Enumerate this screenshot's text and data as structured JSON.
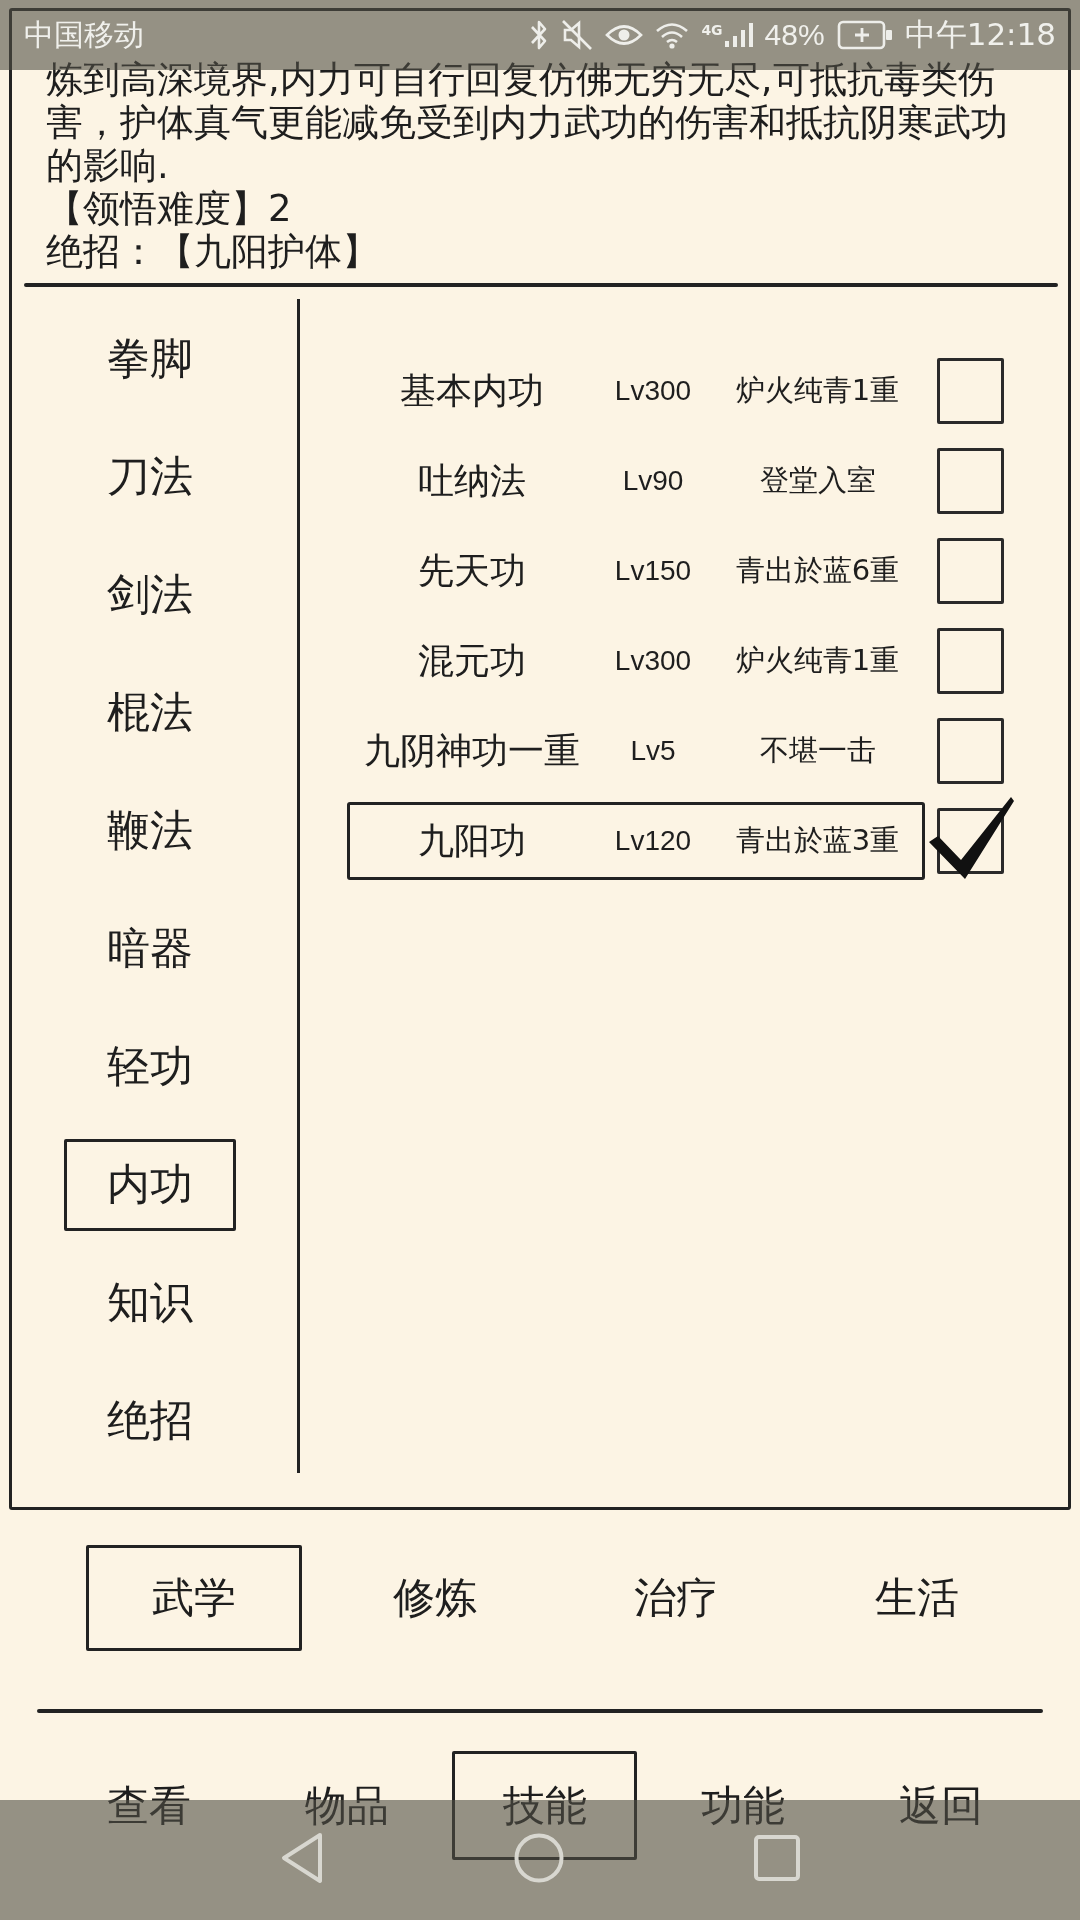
{
  "status_bar": {
    "carrier": "中国移动",
    "network": "4G",
    "battery": "48%",
    "time": "中午12:18"
  },
  "skill_info": {
    "description": "炼到高深境界,内力可自行回复仿佛无穷无尽,可抵抗毒类伤害，护体真气更能减免受到内力武功的伤害和抵抗阴寒武功的影响.",
    "difficulty": "【领悟难度】2",
    "ultimate": "绝招：【九阳护体】"
  },
  "categories": [
    {
      "label": "拳脚",
      "selected": false
    },
    {
      "label": "刀法",
      "selected": false
    },
    {
      "label": "剑法",
      "selected": false
    },
    {
      "label": "棍法",
      "selected": false
    },
    {
      "label": "鞭法",
      "selected": false
    },
    {
      "label": "暗器",
      "selected": false
    },
    {
      "label": "轻功",
      "selected": false
    },
    {
      "label": "内功",
      "selected": true
    },
    {
      "label": "知识",
      "selected": false
    },
    {
      "label": "绝招",
      "selected": false
    }
  ],
  "skills": [
    {
      "name": "基本内功",
      "lv": "Lv300",
      "realm": "炉火纯青1重",
      "selected": false,
      "checked": false
    },
    {
      "name": "吐纳法",
      "lv": "Lv90",
      "realm": "登堂入室",
      "selected": false,
      "checked": false
    },
    {
      "name": "先天功",
      "lv": "Lv150",
      "realm": "青出於蓝6重",
      "selected": false,
      "checked": false
    },
    {
      "name": "混元功",
      "lv": "Lv300",
      "realm": "炉火纯青1重",
      "selected": false,
      "checked": false
    },
    {
      "name": "九阴神功一重",
      "lv": "Lv5",
      "realm": "不堪一击",
      "selected": false,
      "checked": false
    },
    {
      "name": "九阳功",
      "lv": "Lv120",
      "realm": "青出於蓝3重",
      "selected": true,
      "checked": true
    }
  ],
  "tabs": [
    {
      "label": "武学",
      "selected": true
    },
    {
      "label": "修炼",
      "selected": false
    },
    {
      "label": "治疗",
      "selected": false
    },
    {
      "label": "生活",
      "selected": false
    }
  ],
  "menu": [
    {
      "label": "查看",
      "selected": false
    },
    {
      "label": "物品",
      "selected": false
    },
    {
      "label": "技能",
      "selected": true
    },
    {
      "label": "功能",
      "selected": false
    },
    {
      "label": "返回",
      "selected": false
    }
  ]
}
